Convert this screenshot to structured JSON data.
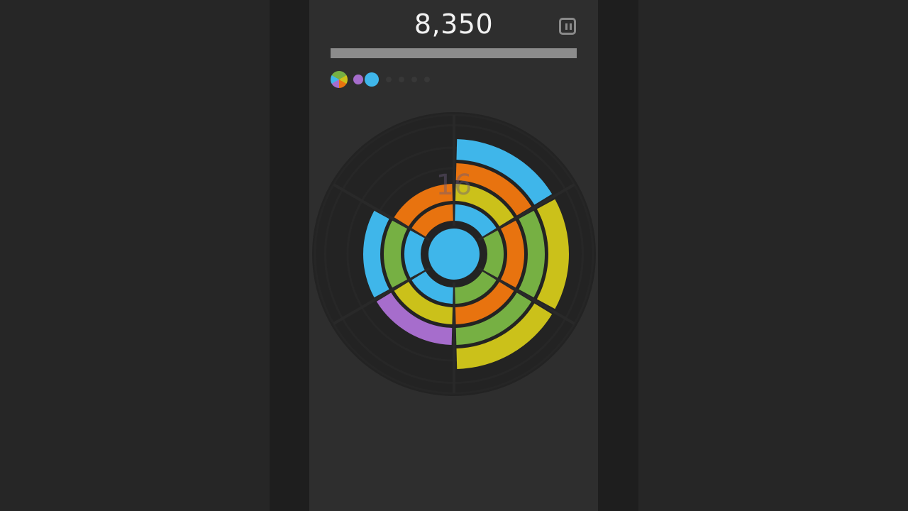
{
  "score": "8,350",
  "progress": 1.0,
  "hint_number": "16",
  "colors": {
    "background": "#242424",
    "panel": "#2e2e2e",
    "board": "#232323",
    "blue": "#3fb6ea",
    "orange": "#e8730f",
    "yellow": "#cbc11a",
    "green": "#76b043",
    "purple": "#a66dcc",
    "progress": "#8c8c8c"
  },
  "queue": [
    {
      "type": "multicolor",
      "icon": "multicolor-piece-icon"
    },
    {
      "type": "color",
      "color": "#a66dcc",
      "icon": "purple-piece-icon"
    },
    {
      "type": "color",
      "color": "#3fb6ea",
      "icon": "blue-piece-icon"
    },
    {
      "type": "empty",
      "icon": "empty-slot-icon"
    },
    {
      "type": "empty",
      "icon": "empty-slot-icon"
    },
    {
      "type": "empty",
      "icon": "empty-slot-icon"
    },
    {
      "type": "empty",
      "icon": "empty-slot-icon"
    }
  ],
  "board": {
    "center_color": "blue",
    "ring_count": 4,
    "sector_count": 6,
    "segments": [
      {
        "ring": 1,
        "sector": 0,
        "color": "blue"
      },
      {
        "ring": 1,
        "sector": 1,
        "color": "green"
      },
      {
        "ring": 1,
        "sector": 2,
        "color": "green"
      },
      {
        "ring": 1,
        "sector": 3,
        "color": "blue"
      },
      {
        "ring": 1,
        "sector": 4,
        "color": "blue"
      },
      {
        "ring": 1,
        "sector": 5,
        "color": "orange"
      },
      {
        "ring": 2,
        "sector": 0,
        "color": "yellow"
      },
      {
        "ring": 2,
        "sector": 1,
        "color": "orange"
      },
      {
        "ring": 2,
        "sector": 2,
        "color": "orange"
      },
      {
        "ring": 2,
        "sector": 3,
        "color": "yellow"
      },
      {
        "ring": 2,
        "sector": 4,
        "color": "green"
      },
      {
        "ring": 2,
        "sector": 5,
        "color": "orange"
      },
      {
        "ring": 3,
        "sector": 0,
        "color": "orange"
      },
      {
        "ring": 3,
        "sector": 1,
        "color": "green"
      },
      {
        "ring": 3,
        "sector": 2,
        "color": "green"
      },
      {
        "ring": 3,
        "sector": 3,
        "color": "purple"
      },
      {
        "ring": 3,
        "sector": 4,
        "color": "blue"
      },
      {
        "ring": 4,
        "sector": 0,
        "color": "blue"
      },
      {
        "ring": 4,
        "sector": 1,
        "color": "yellow"
      },
      {
        "ring": 4,
        "sector": 2,
        "color": "yellow"
      }
    ]
  }
}
